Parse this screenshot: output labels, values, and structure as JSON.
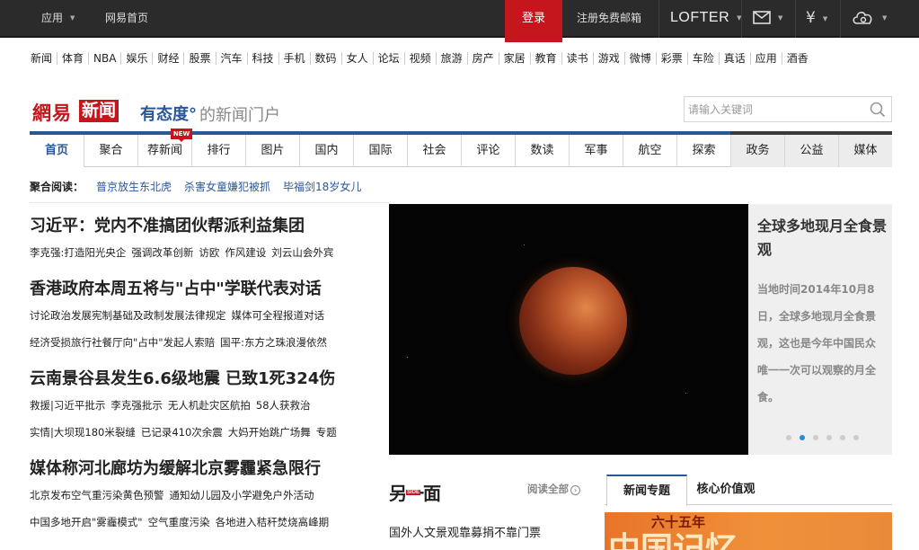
{
  "topbar": {
    "app": "应用",
    "home": "网易首页",
    "login": "登录",
    "register": "注册免费邮箱",
    "lofter": "LOFTER"
  },
  "channels": [
    "新闻",
    "体育",
    "NBA",
    "娱乐",
    "财经",
    "股票",
    "汽车",
    "科技",
    "手机",
    "数码",
    "女人",
    "论坛",
    "视频",
    "旅游",
    "房产",
    "家居",
    "教育",
    "读书",
    "游戏",
    "微博",
    "彩票",
    "车险",
    "真话",
    "应用",
    "酒香"
  ],
  "brand": {
    "logo": "網易",
    "logo_box": "新闻",
    "slogan": "有态度°",
    "slogan_tail": "的新闻门户"
  },
  "search": {
    "placeholder": "请输入关键词"
  },
  "nav": {
    "tabs": [
      "首页",
      "聚合",
      "荐新闻",
      "排行",
      "图片",
      "国内",
      "国际",
      "社会",
      "评论",
      "数读",
      "军事",
      "航空",
      "探索",
      "政务",
      "公益",
      "媒体"
    ],
    "badge": "NEW"
  },
  "agg": {
    "label": "聚合阅读：",
    "links": [
      "普京放生东北虎",
      "杀害女童嫌犯被抓",
      "毕福剑18岁女儿"
    ]
  },
  "news": [
    {
      "title": "习近平：党内不准搞团伙帮派利益集团",
      "subs": [
        [
          "李克强:打造阳光央企",
          "强调改革创新",
          "访欧",
          "作风建设",
          "刘云山会外宾"
        ]
      ]
    },
    {
      "title": "香港政府本周五将与\"占中\"学联代表对话",
      "subs": [
        [
          "讨论政治发展宪制基础及政制发展法律规定",
          "媒体可全程报道对话"
        ],
        [
          "经济受损旅行社餐厅向\"占中\"发起人索赔",
          "国平:东方之珠浪漫依然"
        ]
      ]
    },
    {
      "title": "云南景谷县发生6.6级地震 已致1死324伤",
      "subs": [
        [
          "救援|习近平批示",
          "李克强批示",
          "无人机赴灾区航拍",
          "58人获救治"
        ],
        [
          "实情|大坝现180米裂缝",
          "已记录410次余震",
          "大妈开始跳广场舞",
          "专题"
        ]
      ]
    },
    {
      "title": "媒体称河北廊坊为缓解北京雾霾紧急限行",
      "subs": [
        [
          "北京发布空气重污染黄色预警",
          "通知幼儿园及小学避免户外活动"
        ],
        [
          "中国多地开启\"雾霾模式\"",
          "空气重度污染",
          "各地进入秸秆焚烧高峰期"
        ]
      ]
    }
  ],
  "slider": {
    "title": "全球多地现月全食景观",
    "desc": "当地时间2014年10月8日，全球多地现月全食景观，这也是今年中国民众唯一一次可以观察的月全食。",
    "dot_count": 6,
    "active_dot": 1
  },
  "side": {
    "logo": "另一面",
    "tag": "SIDE",
    "readall": "阅读全部",
    "item": "国外人文景观靠募捐不靠门票"
  },
  "topics": {
    "tabs": [
      "新闻专题",
      "核心价值观"
    ],
    "img_big": "中国记忆",
    "img_small": "六十五年"
  },
  "colors": {
    "accent": "#2b5797",
    "brand_red": "#c4161c"
  }
}
